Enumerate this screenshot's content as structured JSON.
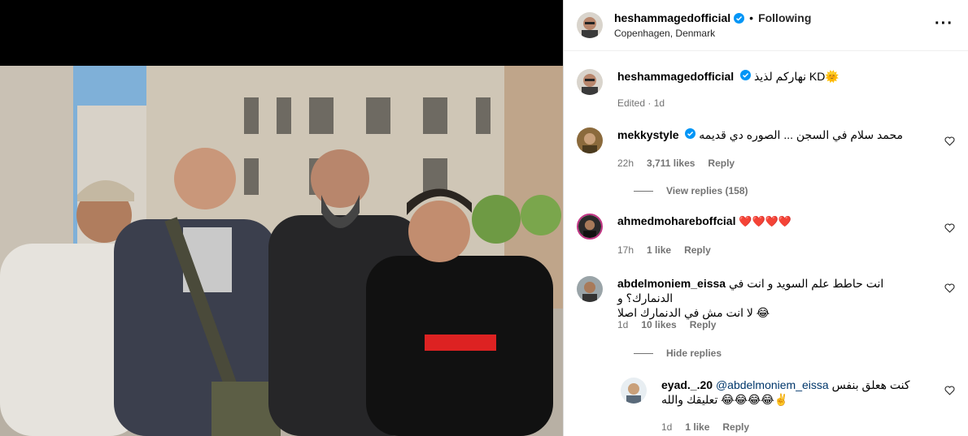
{
  "post": {
    "username": "heshammagedofficial",
    "following_label": "Following",
    "location": "Copenhagen, Denmark",
    "more_icon": "more-options-icon"
  },
  "caption": {
    "username": "heshammagedofficial",
    "text": "نهاركم لذيذ KD🌞",
    "edited": "Edited",
    "time": "1d"
  },
  "comments": [
    {
      "username": "mekkystyle",
      "verified": true,
      "text": "محمد سلام في السجن ... الصوره دي قديمه",
      "time": "22h",
      "likes": "3,711 likes",
      "reply": "Reply",
      "toggle": "View replies (158)"
    },
    {
      "username": "ahmedmohareboffcial",
      "verified": false,
      "text": "❤️❤️❤️❤️",
      "time": "17h",
      "likes": "1 like",
      "reply": "Reply"
    },
    {
      "username": "abdelmoniem_eissa",
      "verified": false,
      "text_line1": "انت حاطط علم السويد و انت في الدنمارك؟ و",
      "text_line2": "لا انت مش في الدنمارك اصلا 😂",
      "time": "1d",
      "likes": "10 likes",
      "reply": "Reply",
      "toggle": "Hide replies"
    }
  ],
  "reply": {
    "username": "eyad._.20",
    "mention": "@abdelmoniem_eissa",
    "text_line1": "كنت هعلق بنفس",
    "text_line2": "تعليقك والله 😂😂😂😂✌️",
    "time": "1d",
    "likes": "1 like",
    "reply": "Reply"
  },
  "colors": {
    "verified_blue": "#0095f6",
    "meta_gray": "#737373",
    "border": "#dbdbdb"
  }
}
